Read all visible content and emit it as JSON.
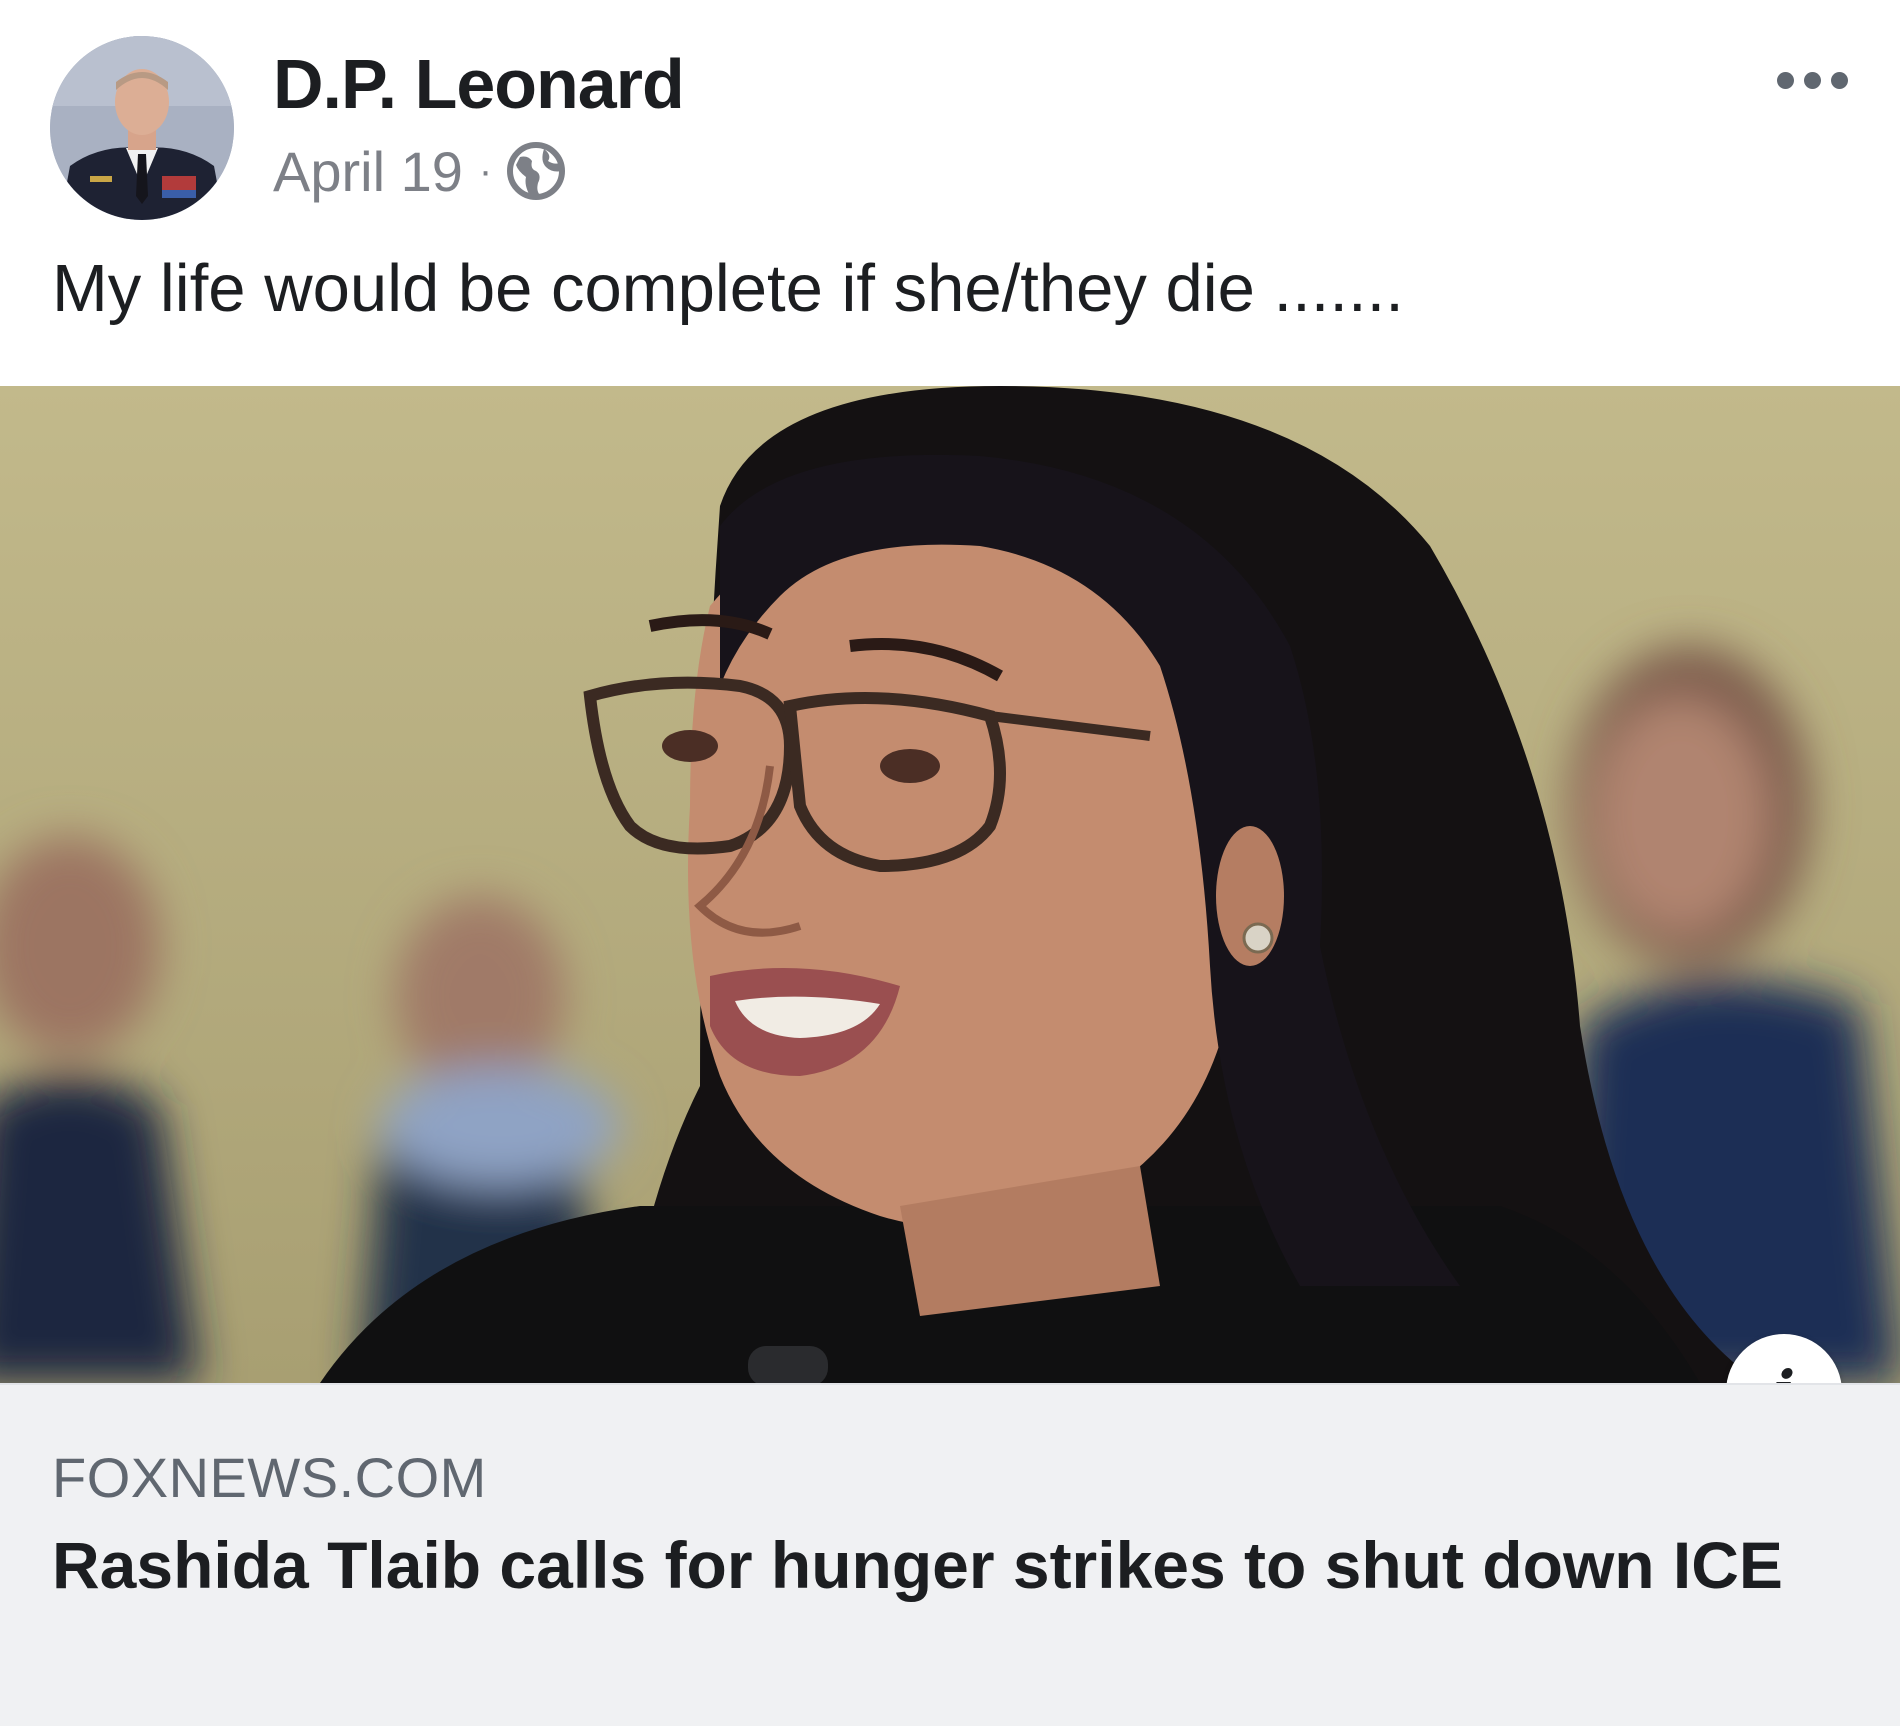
{
  "post": {
    "author": "D.P. Leonard",
    "date": "April 19",
    "separator": "·",
    "privacy_icon": "globe-icon",
    "more_icon": "more-options-icon",
    "message": "My life would be complete if she/they die ......."
  },
  "link_preview": {
    "domain": "FOXNEWS.COM",
    "headline": "Rashida Tlaib calls for hunger strikes to shut down ICE",
    "info_label": "i",
    "image": "photo-of-woman-with-glasses-speaking"
  },
  "colors": {
    "text_primary": "#1c1e21",
    "text_secondary": "#606770",
    "caption_background": "#f0f1f3"
  }
}
